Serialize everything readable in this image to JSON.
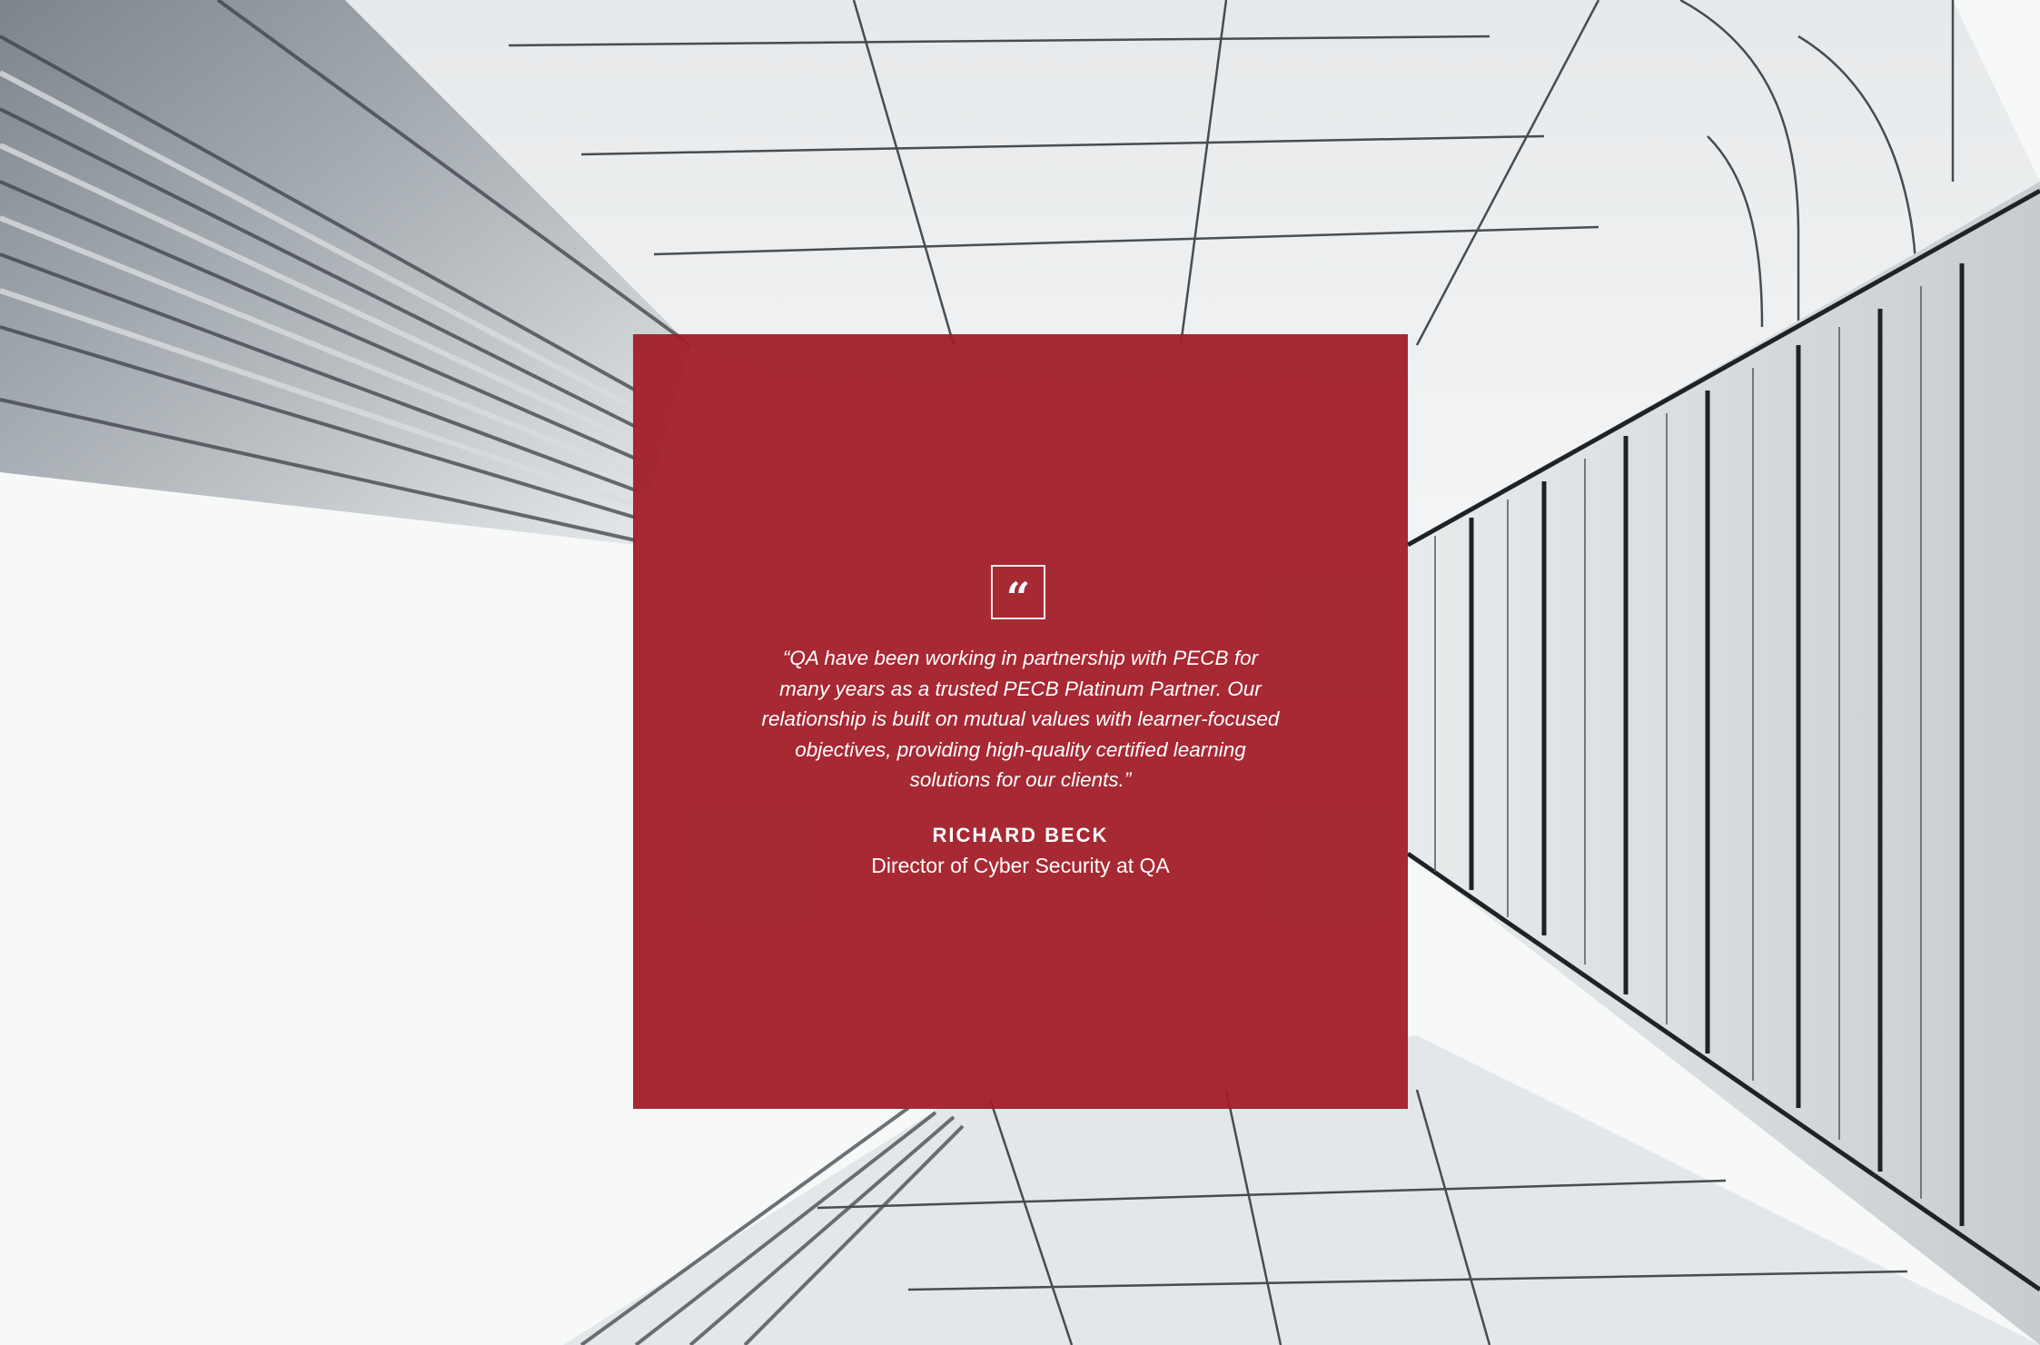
{
  "testimonial": {
    "quote_icon": "quote-icon",
    "quote": "“QA have been working in partnership with PECB for many years as a trusted PECB Platinum Partner. Our relationship is built on mutual values with learner-focused objectives, providing high-quality certified learning solutions for our clients.”",
    "author_name": "RICHARD BECK",
    "author_role": "Director of Cyber Security at QA"
  },
  "colors": {
    "card": "#a01c26",
    "text": "#ffffff",
    "background": "#f7f8f8"
  }
}
